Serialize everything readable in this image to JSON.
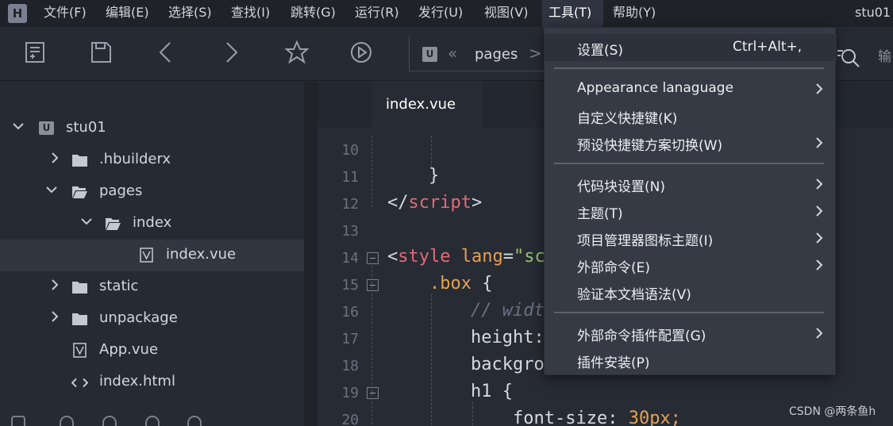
{
  "app": {
    "logo": "H",
    "window_title": "stu01"
  },
  "menubar": [
    {
      "label": "文件(F)"
    },
    {
      "label": "编辑(E)"
    },
    {
      "label": "选择(S)"
    },
    {
      "label": "查找(I)"
    },
    {
      "label": "跳转(G)"
    },
    {
      "label": "运行(R)"
    },
    {
      "label": "发行(U)"
    },
    {
      "label": "视图(V)"
    },
    {
      "label": "工具(T)"
    },
    {
      "label": "帮助(Y)"
    }
  ],
  "toolbar": {
    "icons": [
      "new-file-icon",
      "save-icon",
      "back-icon",
      "forward-icon",
      "star-icon",
      "run-icon"
    ],
    "breadcrumb": {
      "icon": "U",
      "arrows": "«",
      "text": "pages",
      "chevron": ">"
    },
    "search_icon": "search-icon",
    "input_label": "输"
  },
  "project_tree": [
    {
      "label": "stu01",
      "type": "project",
      "icon_letter": "U",
      "expanded": true
    },
    {
      "label": ".hbuilderx",
      "type": "folder",
      "expanded": false
    },
    {
      "label": "pages",
      "type": "folder",
      "expanded": true
    },
    {
      "label": "index",
      "type": "folder",
      "expanded": true
    },
    {
      "label": "index.vue",
      "type": "vue-file",
      "selected": true
    },
    {
      "label": "static",
      "type": "folder",
      "expanded": false
    },
    {
      "label": "unpackage",
      "type": "folder",
      "expanded": false
    },
    {
      "label": "App.vue",
      "type": "vue-file"
    },
    {
      "label": "index.html",
      "type": "html-file"
    }
  ],
  "editor": {
    "tab_label": "index.vue",
    "line_numbers": [
      "10",
      "11",
      "12",
      "13",
      "14",
      "15",
      "16",
      "17",
      "18",
      "19",
      "20"
    ],
    "code": {
      "l11_brace": "}",
      "l12_lt": "</",
      "l12_tag": "script",
      "l12_gt": ">",
      "l14_lt": "<",
      "l14_tag": "style",
      "l14_attr": "lang",
      "l14_eq": "=",
      "l14_val": "\"sc",
      "l15_sel": ".box",
      "l15_brace": "{",
      "l16_comment": "// widt",
      "l17_prop": "height:",
      "l18_prop": "backgro",
      "l19_sel": "h1",
      "l19_brace": "{",
      "l20_prop": "font-size:",
      "l20_val": "30px;"
    },
    "colors": {
      "tag": "#e06c75",
      "attr": "#e5a255",
      "string": "#98c379",
      "comment": "#6b7180",
      "selector": "#e5a255",
      "number": "#e5a255",
      "default": "#d7dae0"
    }
  },
  "tools_menu": {
    "items": [
      {
        "label": "设置(S)",
        "shortcut": "Ctrl+Alt+,",
        "submenu": false,
        "highlighted": true
      },
      {
        "label": "Appearance lanaguage",
        "submenu": true
      },
      {
        "label": "自定义快捷键(K)",
        "submenu": false
      },
      {
        "label": "预设快捷键方案切换(W)",
        "submenu": true
      },
      {
        "label": "代码块设置(N)",
        "submenu": true
      },
      {
        "label": "主题(T)",
        "submenu": true
      },
      {
        "label": "项目管理器图标主题(I)",
        "submenu": true
      },
      {
        "label": "外部命令(E)",
        "submenu": true
      },
      {
        "label": "验证本文档语法(V)",
        "submenu": false
      },
      {
        "label": "外部命令插件配置(G)",
        "submenu": true
      },
      {
        "label": "插件安装(P)",
        "submenu": false
      }
    ]
  },
  "watermark": "CSDN @两条鱼h"
}
